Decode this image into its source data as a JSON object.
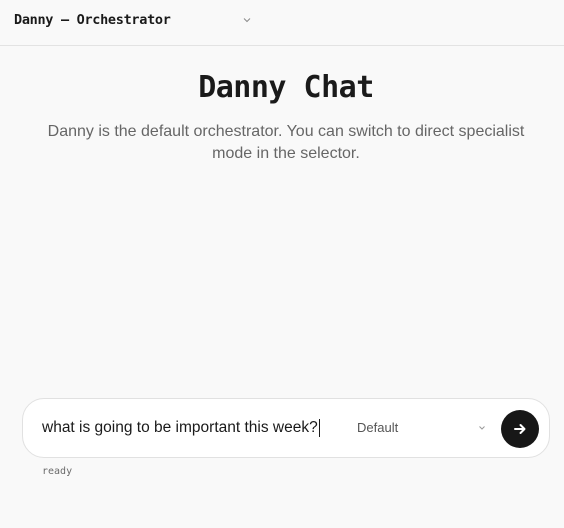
{
  "header": {
    "agent_selector": {
      "selected_label": "Danny — Orchestrator",
      "icon": "chevron-down-icon"
    }
  },
  "hero": {
    "title": "Danny Chat",
    "subtitle": "Danny is the default orchestrator. You can switch to direct specialist mode in the selector."
  },
  "composer": {
    "input_value": "what is going to be important this week?",
    "mode_selector": {
      "selected_label": "Default",
      "icon": "chevron-down-icon"
    },
    "send_button_icon": "arrow-right-icon"
  },
  "status": {
    "text": "ready"
  },
  "colors": {
    "background": "#f9f9f9",
    "send_button": "#171717",
    "subtitle_text": "#666666"
  }
}
